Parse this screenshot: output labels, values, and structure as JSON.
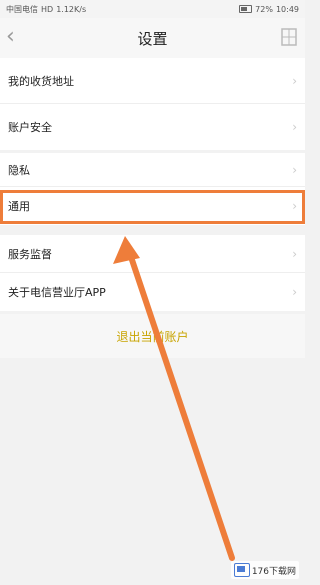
{
  "status_bar": {
    "carrier": "中国电信",
    "network": "HD",
    "speed": "1.12K/s",
    "battery": "72%",
    "time": "10:49"
  },
  "nav": {
    "title": "设置",
    "back_icon": "chevron-left-icon",
    "right_icon": "qr-grid-icon"
  },
  "settings": {
    "group1": [
      {
        "label": "我的收货地址"
      },
      {
        "label": "账户安全"
      }
    ],
    "group2": [
      {
        "label": "隐私"
      },
      {
        "label": "通用"
      }
    ],
    "group3": [
      {
        "label": "服务监督"
      },
      {
        "label": "关于电信营业厅APP"
      }
    ]
  },
  "logout_label": "退出当前账户",
  "annotation": {
    "highlight_color": "#ee7d3a",
    "arrow_color": "#ee7d3a"
  },
  "watermark": {
    "text": "176下载网"
  }
}
